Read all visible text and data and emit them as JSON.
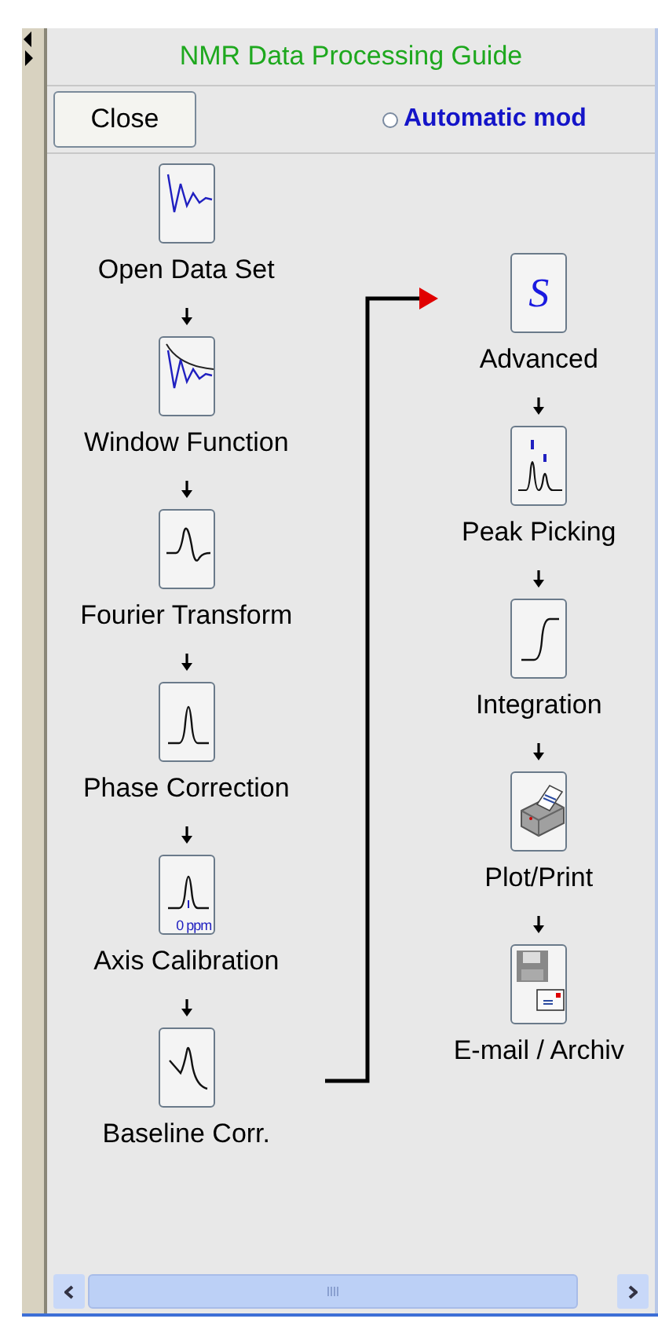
{
  "title": "NMR Data Processing Guide",
  "toolbar": {
    "close_button": "Close",
    "mode_radio": {
      "label": "Automatic mod",
      "selected": false
    }
  },
  "columns": [
    {
      "steps": [
        {
          "label": "Open Data Set",
          "kind": "fid"
        },
        {
          "label": "Window Function",
          "kind": "window"
        },
        {
          "label": "Fourier Transform",
          "kind": "dispersion"
        },
        {
          "label": "Phase Correction",
          "kind": "peak"
        },
        {
          "label": "Axis Calibration",
          "kind": "calibration",
          "icon_text": "0 ppm"
        },
        {
          "label": "Baseline Corr.",
          "kind": "baseline"
        }
      ]
    },
    {
      "steps": [
        {
          "label": "Advanced",
          "kind": "script",
          "glyph": "S"
        },
        {
          "label": "Peak Picking",
          "kind": "peaks"
        },
        {
          "label": "Integration",
          "kind": "integral"
        },
        {
          "label": "Plot/Print",
          "kind": "printer"
        },
        {
          "label": "E-mail / Archiv",
          "kind": "archive"
        }
      ]
    }
  ]
}
